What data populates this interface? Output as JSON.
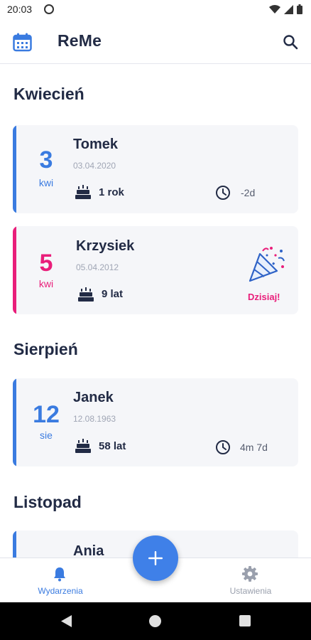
{
  "status_bar": {
    "time": "20:03"
  },
  "app_bar": {
    "title": "ReMe"
  },
  "sections": [
    {
      "month": "Kwiecień",
      "cards": [
        {
          "day": "3",
          "month_short": "kwi",
          "name": "Tomek",
          "date": "03.04.2020",
          "age": "1 rok",
          "until": "-2d",
          "accent": "#3a7be0"
        },
        {
          "day": "5",
          "month_short": "kwi",
          "name": "Krzysiek",
          "date": "05.04.2012",
          "age": "9 lat",
          "today": "Dzisiaj!",
          "accent": "#e91e7a"
        }
      ]
    },
    {
      "month": "Sierpień",
      "cards": [
        {
          "day": "12",
          "month_short": "sie",
          "name": "Janek",
          "date": "12.08.1963",
          "age": "58 lat",
          "until": "4m 7d",
          "accent": "#3a7be0"
        }
      ]
    },
    {
      "month": "Listopad",
      "cards": [
        {
          "name": "Ania",
          "accent": "#3a7be0"
        }
      ]
    }
  ],
  "bottom_nav": [
    {
      "label": "Wydarzenia",
      "icon": "bell-icon",
      "active": true,
      "color": "#3a7be0"
    },
    {
      "label": "Ustawienia",
      "icon": "gear-icon",
      "active": false,
      "color": "#9aa0ad"
    }
  ],
  "fab": {
    "icon": "plus-icon",
    "color": "#3f80e8"
  }
}
